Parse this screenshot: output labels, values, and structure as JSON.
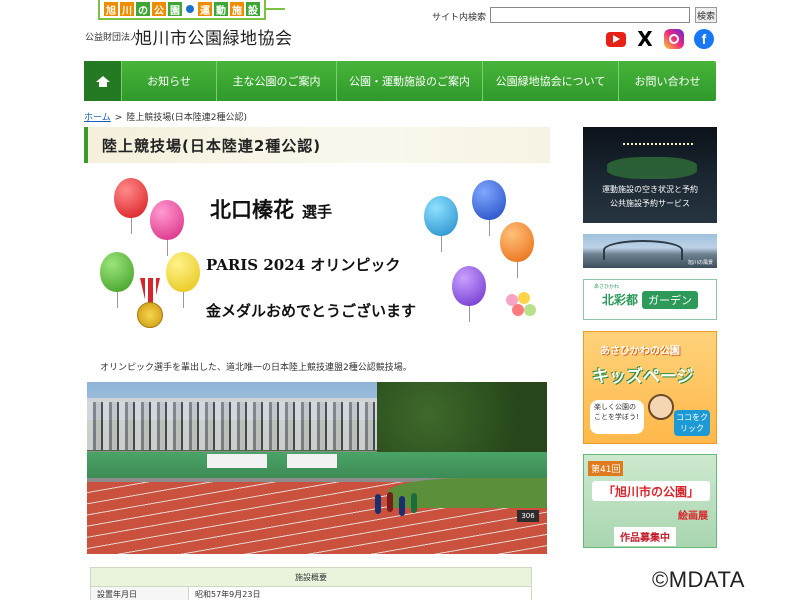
{
  "header": {
    "logo_chars": [
      "旭",
      "川",
      "の",
      "公",
      "園",
      "運",
      "動",
      "施",
      "設"
    ],
    "org_small": "公益財団法人",
    "org_name": "旭川市公園緑地協会",
    "search_label": "サイト内検索",
    "search_value": "",
    "search_button": "検索",
    "social": [
      "youtube-icon",
      "x-icon",
      "instagram-icon",
      "facebook-icon"
    ],
    "x_glyph": "X",
    "fb_glyph": "f"
  },
  "nav": {
    "items": [
      "お知らせ",
      "主な公園のご案内",
      "公園・運動施設のご案内",
      "公園緑地協会について",
      "お問い合わせ"
    ]
  },
  "breadcrumb": {
    "home": "ホーム",
    "separator": ">",
    "current": "陸上競技場(日本陸連2種公認)"
  },
  "page": {
    "title": "陸上競技場(日本陸連2種公認)",
    "intro": "オリンピック選手を輩出した、道北唯一の日本陸上競技連盟2種公認競技場。"
  },
  "banner": {
    "name": "北口榛花",
    "suffix": "選手",
    "line2": "PARIS 2024 オリンピック",
    "line3": "金メダルおめでとうございます"
  },
  "photo": {
    "sign": "306"
  },
  "table": {
    "header": "施設概要",
    "rows": [
      {
        "key": "設置年月日",
        "value": "昭和57年9月23日"
      }
    ]
  },
  "sidebar": {
    "s1_caption_1": "運動施設の空き状況と予約",
    "s1_caption_2": "公共施設予約サービス",
    "s2_caption": "旭川の風景",
    "s3_small": "あさひかわ",
    "s3_t1": "北彩都",
    "s3_t2": "ガーデン",
    "s4_sub": "あさひかわの公園",
    "s4_main": "キッズページ",
    "s4_bubble": "楽しく公園のことを学ぼう!",
    "s4_button": "ココをクリック",
    "s5_num": "第41回",
    "s5_title": "「旭川市の公園」",
    "s5_t2": "絵画展",
    "s5_t3": "作品募集中"
  },
  "watermark": "©MDATA",
  "colors": {
    "nav_green": "#3fa535",
    "nav_home": "#237a22",
    "title_bar": "#3a9a2e",
    "link": "#1a5fb4"
  }
}
